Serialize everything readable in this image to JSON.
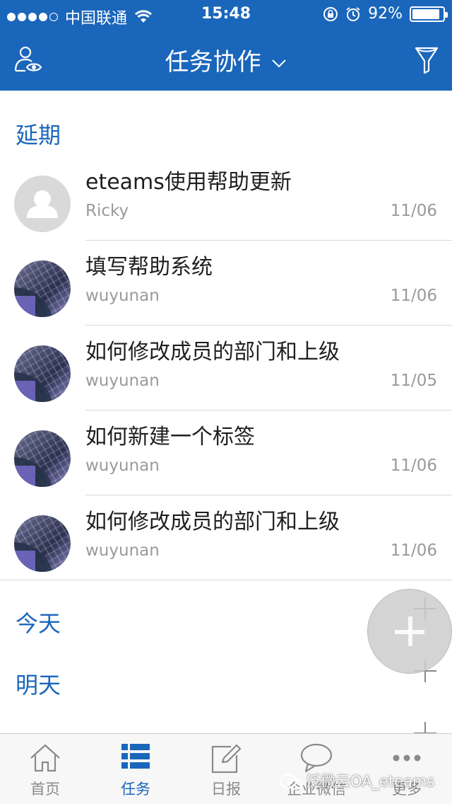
{
  "status_bar": {
    "carrier": "中国联通",
    "time": "15:48",
    "battery_percent_text": "92%",
    "battery_level": 0.92
  },
  "navbar": {
    "title": "任务协作",
    "left_icon": "user-eye-icon",
    "right_icon": "filter-funnel-icon",
    "title_icon": "chevron-down-icon"
  },
  "sections": {
    "overdue": "延期",
    "today": "今天",
    "tomorrow": "明天"
  },
  "tasks": [
    {
      "title": "eteams使用帮助更新",
      "author": "Ricky",
      "date": "11/06",
      "avatar": "default-avatar"
    },
    {
      "title": "填写帮助系统",
      "author": "wuyunan",
      "date": "11/06",
      "avatar": "photo-avatar"
    },
    {
      "title": "如何修改成员的部门和上级",
      "author": "wuyunan",
      "date": "11/05",
      "avatar": "photo-avatar"
    },
    {
      "title": "如何新建一个标签",
      "author": "wuyunan",
      "date": "11/06",
      "avatar": "photo-avatar"
    },
    {
      "title": "如何修改成员的部门和上级",
      "author": "wuyunan",
      "date": "11/06",
      "avatar": "photo-avatar"
    }
  ],
  "tabs": [
    {
      "label": "首页",
      "icon": "home-icon"
    },
    {
      "label": "任务",
      "icon": "task-list-icon",
      "active": true
    },
    {
      "label": "日报",
      "icon": "edit-note-icon"
    },
    {
      "label": "企业微信",
      "icon": "chat-bubble-icon"
    },
    {
      "label": "更多",
      "icon": "more-dots-icon"
    }
  ],
  "watermark": "泛微云OA_eteams",
  "colors": {
    "brand_blue": "#1a66bb",
    "muted_text": "#9a9a9a"
  }
}
